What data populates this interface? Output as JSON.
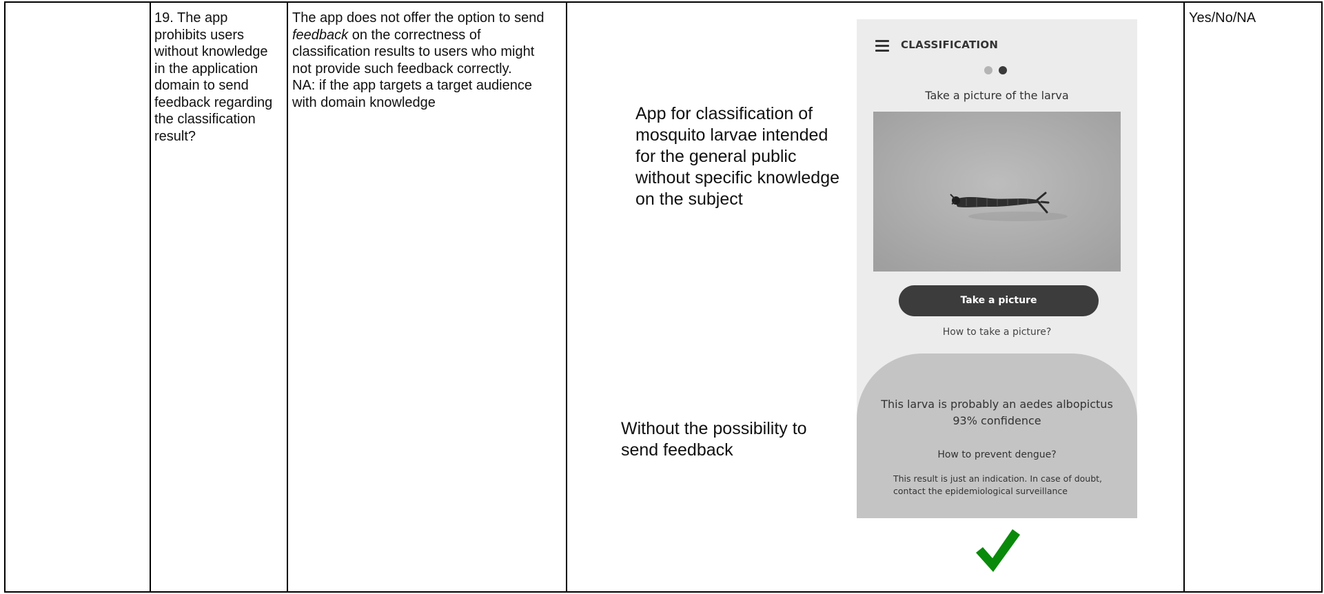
{
  "criterion": {
    "text": "19. The app\nprohibits users\nwithout knowledge\nin the application\ndomain to send\nfeedback regarding\nthe classification\nresult?"
  },
  "description": {
    "line1": "The app does not offer the option to send",
    "feedback_word": "feedback",
    "line2_rest": " on the correctness of",
    "rest": "classification results to users who might\nnot provide such feedback correctly.\nNA: if the app targets a target audience\nwith domain knowledge"
  },
  "example": {
    "annotation_top": "App for classification of\nmosquito larvae intended\nfor the general public\nwithout specific knowledge\non the subject",
    "annotation_bottom": "Without the possibility to\nsend feedback",
    "phone": {
      "menu_icon": "hamburger-menu-icon",
      "title": "CLASSIFICATION",
      "step_indicator": {
        "total": 2,
        "active": 2
      },
      "step_label": "Take a picture of the larva",
      "photo_subject": "mosquito larva photo",
      "take_picture_button": "Take a picture",
      "how_to_link": "How to take a picture?",
      "result_line1": "This larva is probably an aedes albopictus",
      "result_line2": "93% confidence",
      "prevent_link": "How to prevent dengue?",
      "disclaimer": "This result is just an indication. In case of doubt, contact the epidemiological surveillance",
      "colors": {
        "background": "#ececec",
        "button": "#3c3c3c",
        "panel": "#c4c4c4"
      }
    },
    "check_icon": "green-checkmark-icon",
    "check_color": "#0a8a0a"
  },
  "answer_options": "Yes/No/NA"
}
